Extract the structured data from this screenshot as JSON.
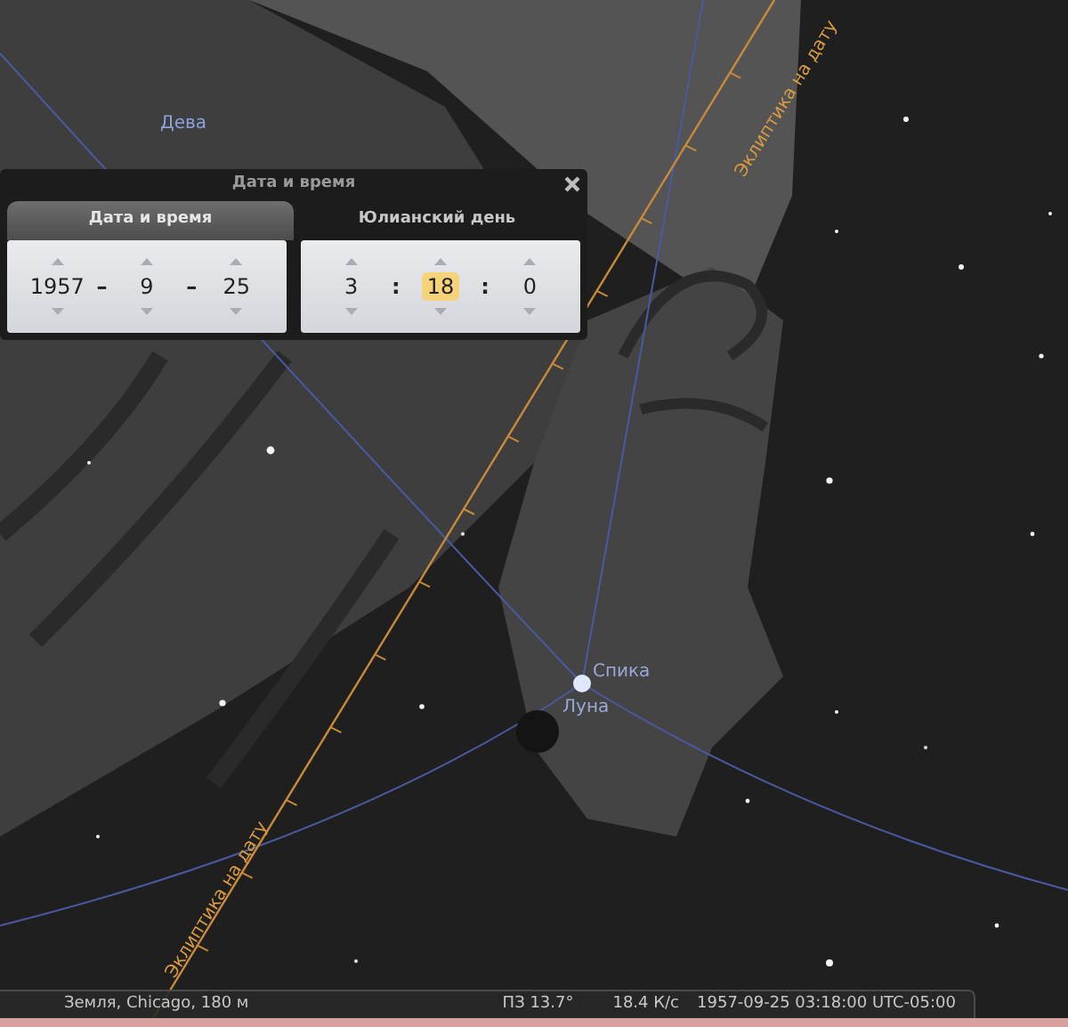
{
  "sky": {
    "labels": [
      {
        "kind": "constellation",
        "text": "Дева"
      },
      {
        "kind": "star",
        "text": "Спика"
      },
      {
        "kind": "planet",
        "text": "Луна"
      }
    ],
    "ecliptic_labels": [
      "Эклиптика на дату",
      "Эклиптика на дату"
    ]
  },
  "dialog": {
    "title": "Дата и время",
    "tabs": [
      {
        "label": "Дата и время",
        "selected": true
      },
      {
        "label": "Юлианский день",
        "selected": false
      }
    ],
    "panels": [
      {
        "separator": "–",
        "fields": [
          {
            "value": "1957",
            "selected": false
          },
          {
            "value": "9",
            "selected": false
          },
          {
            "value": "25",
            "selected": false
          }
        ]
      },
      {
        "separator": ":",
        "fields": [
          {
            "value": "3",
            "selected": false
          },
          {
            "value": "18",
            "selected": true
          },
          {
            "value": "0",
            "selected": false
          }
        ]
      }
    ]
  },
  "status_bar": {
    "location": "Земля, Chicago, 180 м",
    "fov": "ПЗ 13.7°",
    "fps": "18.4 К/с",
    "datetime": "1957-09-25 03:18:00 UTC-05:00"
  }
}
